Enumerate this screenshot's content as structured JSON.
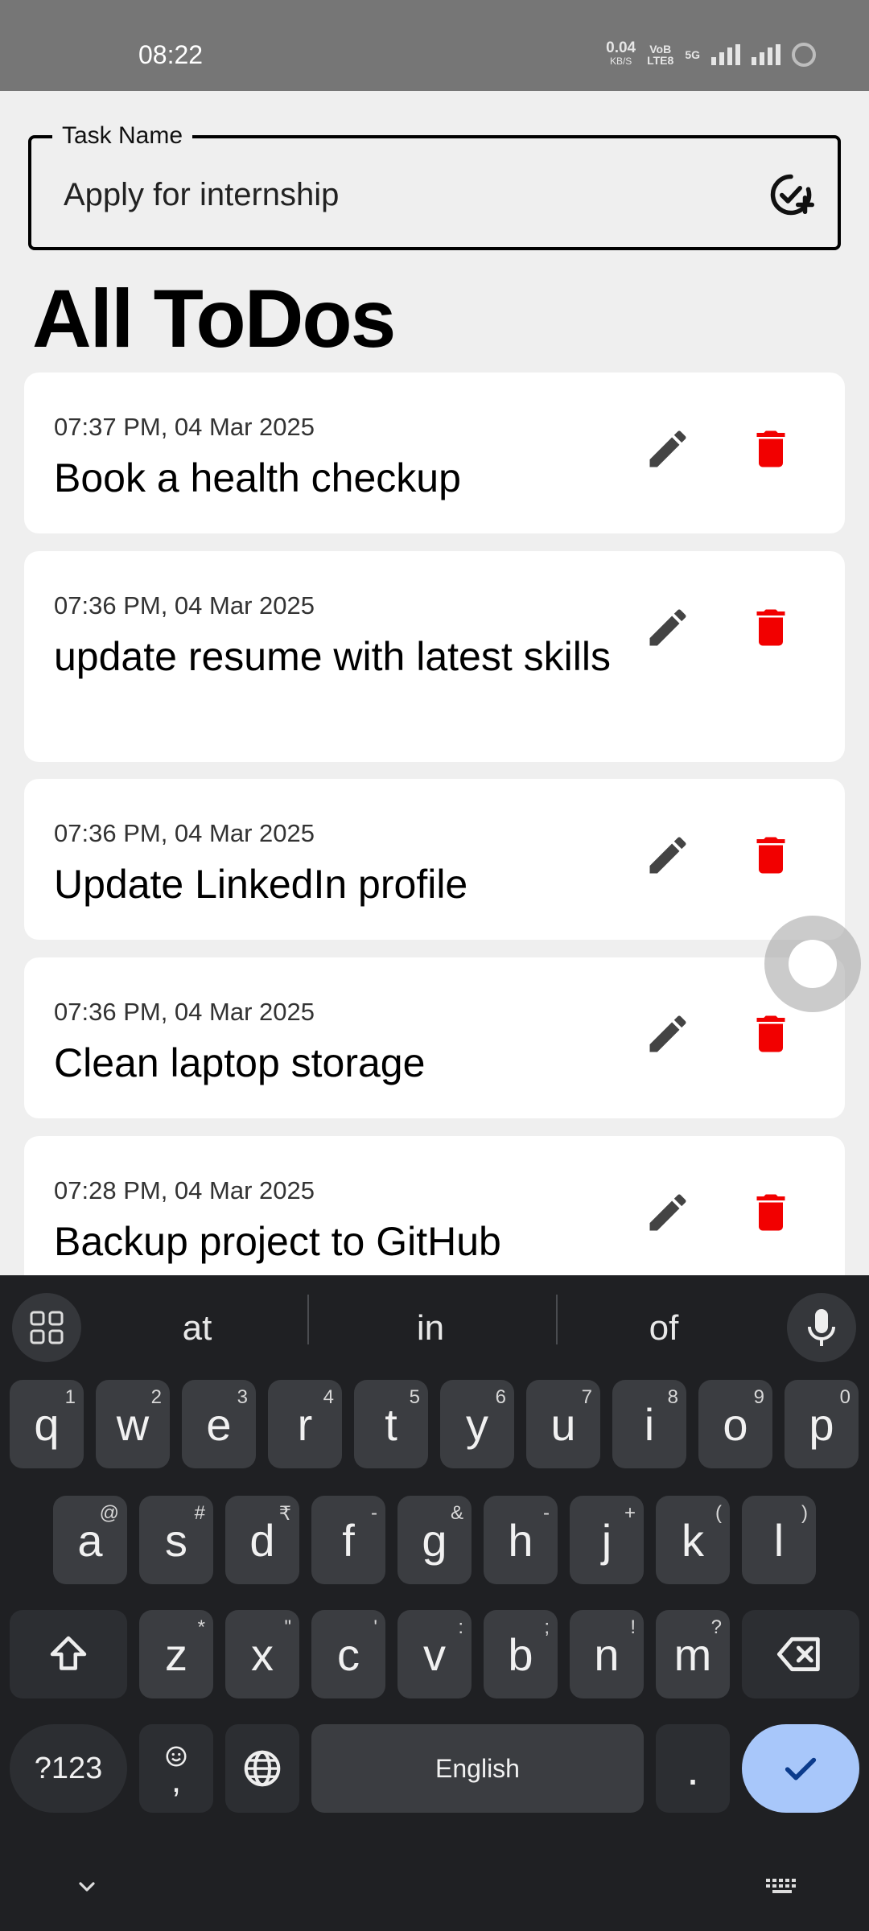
{
  "status_bar": {
    "time": "08:22",
    "net_speed_value": "0.04",
    "net_speed_unit": "KB/S",
    "volte_top": "VoB",
    "volte_bottom": "LTE8",
    "network": "5G"
  },
  "task_input": {
    "label": "Task Name",
    "value": "Apply for internship",
    "add_icon": "check-circle-plus-icon"
  },
  "page_title": "All ToDos",
  "todos": [
    {
      "time": "07:37 PM, 04 Mar 2025",
      "title": "Book a health checkup"
    },
    {
      "time": "07:36 PM, 04 Mar 2025",
      "title": "update resume with latest skills"
    },
    {
      "time": "07:36 PM, 04 Mar 2025",
      "title": "Update LinkedIn profile"
    },
    {
      "time": "07:36 PM, 04 Mar 2025",
      "title": "Clean laptop storage"
    },
    {
      "time": "07:28 PM, 04 Mar 2025",
      "title": "Backup project to GitHub"
    }
  ],
  "colors": {
    "delete": "#f20000",
    "edit": "#444444",
    "background": "#efefef",
    "status_bar": "#767676",
    "keyboard": "#1f2023",
    "enter_key": "#a8c7fa"
  },
  "keyboard": {
    "suggestions": [
      "at",
      "in",
      "of"
    ],
    "row1": [
      {
        "k": "q",
        "s": "1"
      },
      {
        "k": "w",
        "s": "2"
      },
      {
        "k": "e",
        "s": "3"
      },
      {
        "k": "r",
        "s": "4"
      },
      {
        "k": "t",
        "s": "5"
      },
      {
        "k": "y",
        "s": "6"
      },
      {
        "k": "u",
        "s": "7"
      },
      {
        "k": "i",
        "s": "8"
      },
      {
        "k": "o",
        "s": "9"
      },
      {
        "k": "p",
        "s": "0"
      }
    ],
    "row2": [
      {
        "k": "a",
        "s": "@"
      },
      {
        "k": "s",
        "s": "#"
      },
      {
        "k": "d",
        "s": "₹"
      },
      {
        "k": "f",
        "s": "-"
      },
      {
        "k": "g",
        "s": "&"
      },
      {
        "k": "h",
        "s": "-"
      },
      {
        "k": "j",
        "s": "+"
      },
      {
        "k": "k",
        "s": "("
      },
      {
        "k": "l",
        "s": ")"
      }
    ],
    "row3": [
      {
        "k": "z",
        "s": "*"
      },
      {
        "k": "x",
        "s": "\""
      },
      {
        "k": "c",
        "s": "'"
      },
      {
        "k": "v",
        "s": ":"
      },
      {
        "k": "b",
        "s": ";"
      },
      {
        "k": "n",
        "s": "!"
      },
      {
        "k": "m",
        "s": "?"
      }
    ],
    "symbols_label": "?123",
    "comma_label": ",",
    "space_label": "English",
    "period_label": "."
  }
}
